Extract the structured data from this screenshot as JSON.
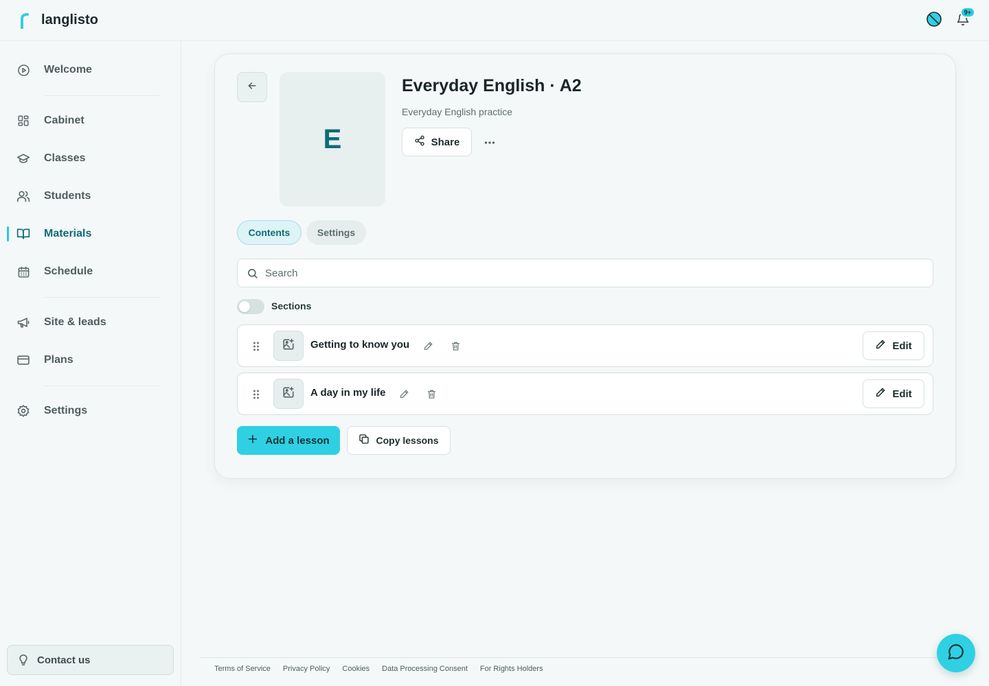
{
  "app": {
    "brand_name": "langlisto",
    "notification_badge": "9+",
    "accent_color": "#2fd0e3",
    "active_color": "#0e6b78"
  },
  "sidebar": {
    "items": [
      {
        "label": "Welcome",
        "icon": "play-circle-icon"
      },
      {
        "label": "Cabinet",
        "icon": "dashboard-grid-icon"
      },
      {
        "label": "Classes",
        "icon": "graduation-cap-icon"
      },
      {
        "label": "Students",
        "icon": "users-icon"
      },
      {
        "label": "Materials",
        "icon": "book-open-icon",
        "active": true
      },
      {
        "label": "Schedule",
        "icon": "calendar-icon"
      },
      {
        "label": "Site & leads",
        "icon": "megaphone-icon"
      },
      {
        "label": "Plans",
        "icon": "credit-card-icon"
      },
      {
        "label": "Settings",
        "icon": "gear-icon"
      }
    ],
    "contact_label": "Contact us"
  },
  "course": {
    "cover_letter": "E",
    "title": "Everyday English · A2",
    "subtitle": "Everyday English practice",
    "share_label": "Share"
  },
  "tabs": [
    {
      "label": "Contents",
      "active": true
    },
    {
      "label": "Settings",
      "active": false
    }
  ],
  "search": {
    "placeholder": "Search",
    "value": ""
  },
  "sections_toggle": {
    "label": "Sections",
    "on": false
  },
  "lessons": [
    {
      "title": "Getting to know you",
      "edit_label": "Edit"
    },
    {
      "title": "A day in my life",
      "edit_label": "Edit"
    }
  ],
  "actions": {
    "add_lesson": "Add a lesson",
    "copy_lessons": "Copy lessons"
  },
  "footer": {
    "links": [
      "Terms of Service",
      "Privacy Policy",
      "Cookies",
      "Data Processing Consent",
      "For Rights Holders"
    ]
  }
}
